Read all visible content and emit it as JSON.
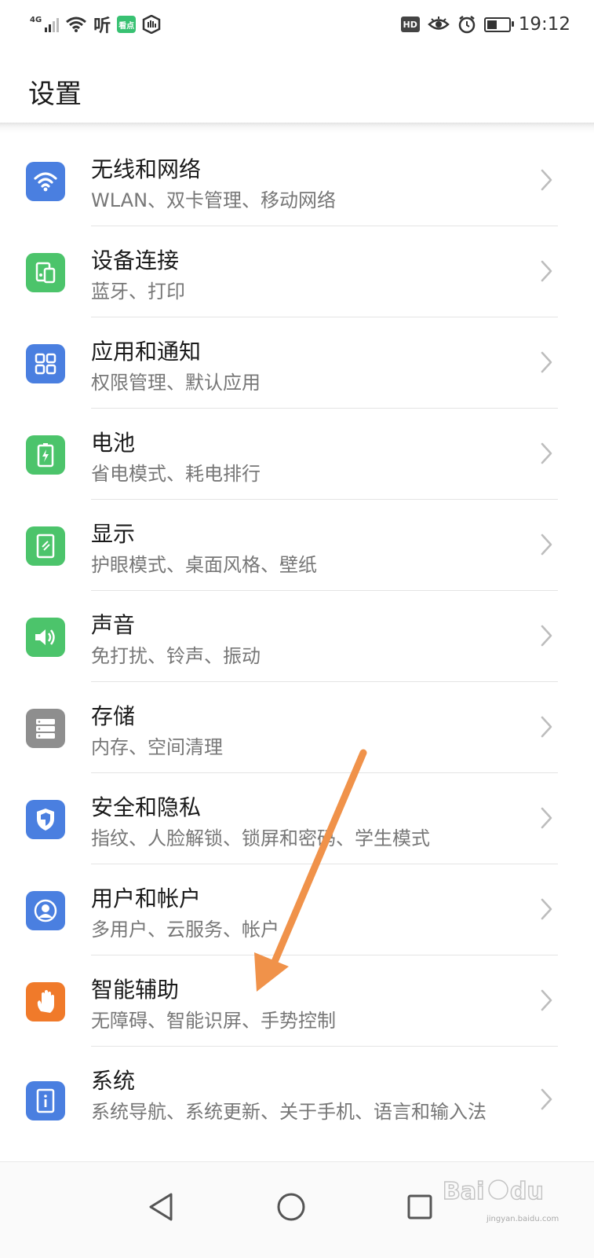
{
  "status_bar": {
    "network": "4G",
    "listen_label": "听",
    "kandian_label": "看点",
    "hd_label": "HD",
    "time": "19:12",
    "battery_level_pct": 55
  },
  "header": {
    "title": "设置"
  },
  "items": [
    {
      "title": "无线和网络",
      "subtitle": "WLAN、双卡管理、移动网络",
      "icon": "wifi-icon",
      "color": "#4a7fe0"
    },
    {
      "title": "设备连接",
      "subtitle": "蓝牙、打印",
      "icon": "device-connect-icon",
      "color": "#4cc46b"
    },
    {
      "title": "应用和通知",
      "subtitle": "权限管理、默认应用",
      "icon": "apps-grid-icon",
      "color": "#4a7fe0"
    },
    {
      "title": "电池",
      "subtitle": "省电模式、耗电排行",
      "icon": "battery-icon",
      "color": "#4cc46b"
    },
    {
      "title": "显示",
      "subtitle": "护眼模式、桌面风格、壁纸",
      "icon": "display-icon",
      "color": "#4cc46b"
    },
    {
      "title": "声音",
      "subtitle": "免打扰、铃声、振动",
      "icon": "sound-icon",
      "color": "#4cc46b"
    },
    {
      "title": "存储",
      "subtitle": "内存、空间清理",
      "icon": "storage-icon",
      "color": "#8e8e8e"
    },
    {
      "title": "安全和隐私",
      "subtitle": "指纹、人脸解锁、锁屏和密码、学生模式",
      "icon": "shield-icon",
      "color": "#4a7fe0"
    },
    {
      "title": "用户和帐户",
      "subtitle": "多用户、云服务、帐户",
      "icon": "user-icon",
      "color": "#4a7fe0"
    },
    {
      "title": "智能辅助",
      "subtitle": "无障碍、智能识屏、手势控制",
      "icon": "hand-icon",
      "color": "#f07a2a"
    },
    {
      "title": "系统",
      "subtitle": "系统导航、系统更新、关于手机、语言和输入法",
      "icon": "system-info-icon",
      "color": "#4a7fe0"
    }
  ],
  "nav": {
    "back": "back-icon",
    "home": "home-icon",
    "recents": "recents-icon"
  },
  "watermark": {
    "brand": "Bai du 经验",
    "url": "jingyan.baidu.com"
  },
  "annotation": {
    "arrow_color": "#f0924a"
  }
}
